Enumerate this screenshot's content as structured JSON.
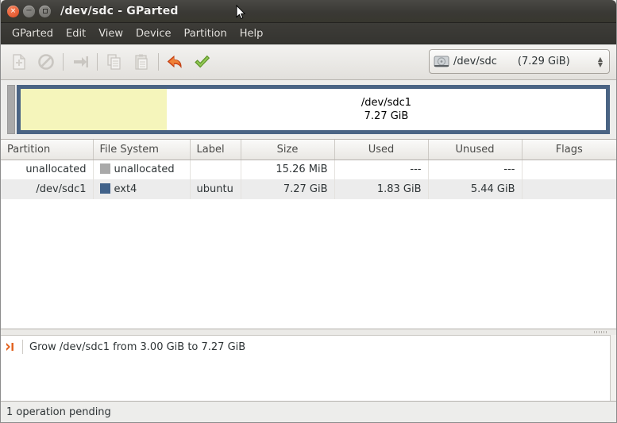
{
  "window": {
    "title": "/dev/sdc - GParted",
    "buttons": [
      {
        "name": "close",
        "glyph": "×"
      },
      {
        "name": "minimize",
        "glyph": "−"
      },
      {
        "name": "maximize",
        "glyph": ""
      }
    ]
  },
  "menubar": {
    "items": [
      "GParted",
      "Edit",
      "View",
      "Device",
      "Partition",
      "Help"
    ]
  },
  "toolbar": {
    "buttons": [
      {
        "name": "new-partition",
        "icon": "new-document-icon",
        "enabled": false
      },
      {
        "name": "delete-partition",
        "icon": "prohibition-icon",
        "enabled": false
      },
      {
        "name": "resize-move-partition",
        "icon": "resize-arrow-icon",
        "enabled": false
      },
      {
        "name": "copy-partition",
        "icon": "copy-icon",
        "enabled": false
      },
      {
        "name": "paste-partition",
        "icon": "paste-icon",
        "enabled": false
      },
      {
        "name": "undo-operation",
        "icon": "undo-arrow-icon",
        "enabled": true
      },
      {
        "name": "apply-operations",
        "icon": "green-check-icon",
        "enabled": true
      }
    ],
    "device_selector": {
      "icon": "hard-disk-icon",
      "device": "/dev/sdc",
      "size": "(7.29 GiB)"
    }
  },
  "disk_graphic": {
    "partition_label": "/dev/sdc1",
    "partition_size": "7.27 GiB",
    "used_color": "#f5f5bb",
    "border_color": "#4a6484",
    "unallocated_color": "#a9a9a9"
  },
  "table": {
    "columns": [
      "Partition",
      "File System",
      "Label",
      "Size",
      "Used",
      "Unused",
      "Flags"
    ],
    "rows": [
      {
        "partition": "unallocated",
        "filesystem": "unallocated",
        "swatch": "#a9a9a9",
        "label": "",
        "size": "15.26 MiB",
        "used": "---",
        "unused": "---",
        "flags": ""
      },
      {
        "partition": "/dev/sdc1",
        "filesystem": "ext4",
        "swatch": "#41628a",
        "label": "ubuntu",
        "size": "7.27 GiB",
        "used": "1.83 GiB",
        "unused": "5.44 GiB",
        "flags": ""
      }
    ]
  },
  "operations": {
    "items": [
      {
        "icon": "grow-partition-icon",
        "text": "Grow /dev/sdc1 from 3.00 GiB to 7.27 GiB"
      }
    ]
  },
  "statusbar": {
    "text": "1 operation pending"
  }
}
